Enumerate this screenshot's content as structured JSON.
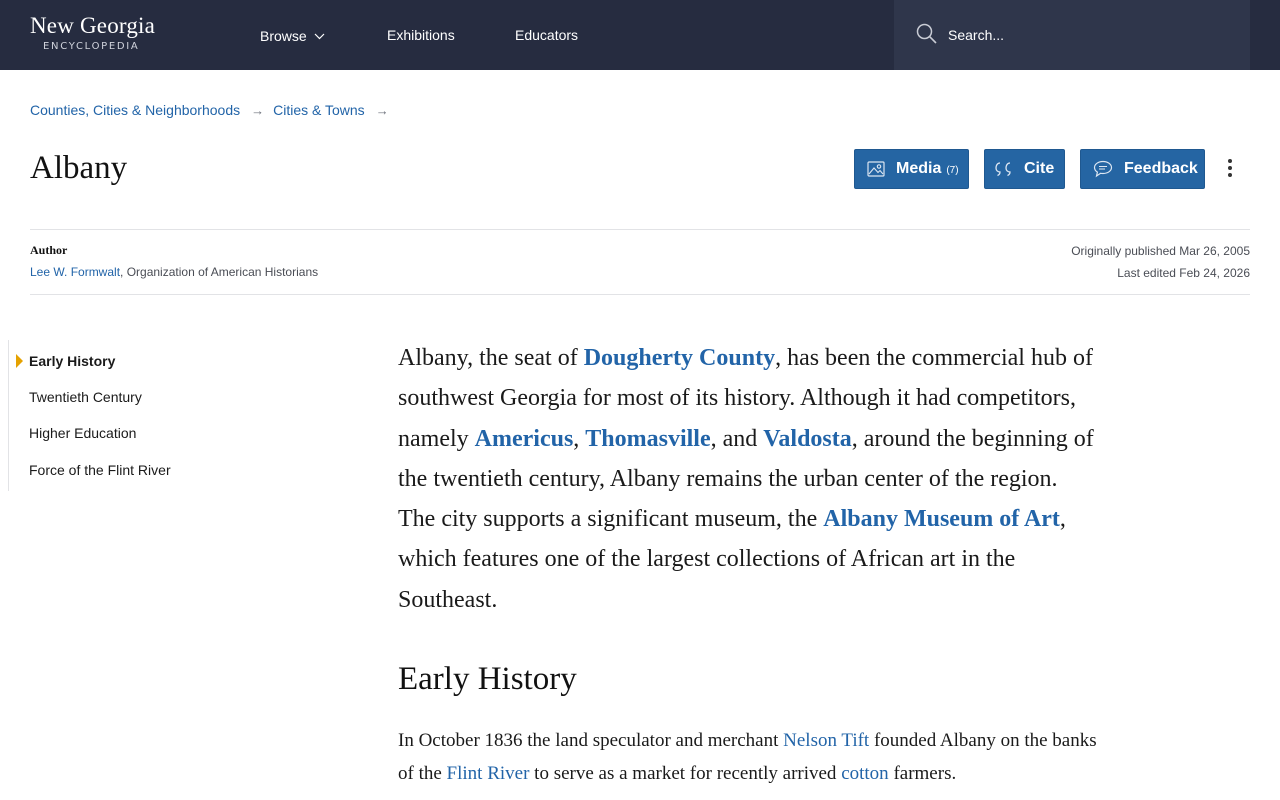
{
  "header": {
    "logo_main": "New Georgia",
    "logo_sub": "ENCYCLOPEDIA",
    "nav": {
      "browse": "Browse",
      "exhibitions": "Exhibitions",
      "educators": "Educators"
    },
    "search_placeholder": "Search...",
    "colors": {
      "bar": "#262c40",
      "search_bg": "#2f364b"
    }
  },
  "breadcrumb": [
    "Counties, Cities & Neighborhoods",
    "Cities & Towns"
  ],
  "title": "Albany",
  "actions": {
    "media_label": "Media",
    "media_count": "(7)",
    "cite_label": "Cite",
    "feedback_label": "Feedback"
  },
  "meta": {
    "author_heading": "Author",
    "author_name": "Lee W. Formwalt",
    "author_affiliation": ", Organization of American Historians",
    "published": "Originally published Mar 26, 2005",
    "edited": "Last edited Feb 24, 2026"
  },
  "toc": [
    "Early History",
    "Twentieth Century",
    "Higher Education",
    "Force of the Flint River"
  ],
  "intro": {
    "t1": "Albany, the seat of ",
    "l1": "Dougherty County",
    "t2": ", has been the commercial hub of southwest Georgia for most of its history. Although it had competitors, namely ",
    "l2": "Americus",
    "t3": ", ",
    "l3": "Thomasville",
    "t4": ", and ",
    "l4": "Valdosta",
    "t5": ", around the beginning of the twentieth century, Albany remains the urban center of the region. The city supports a significant museum, the ",
    "l5": "Albany Museum of Art",
    "t6": ", which features one of the largest collections of African art in the Southeast."
  },
  "section": {
    "heading": "Early History",
    "t1": "In October 1836 the land speculator and merchant ",
    "l1": "Nelson Tift",
    "t2": " founded Albany on the banks of the ",
    "l2": "Flint River",
    "t3": " to serve as a market for recently arrived ",
    "l3": "cotton",
    "t4": " farmers."
  },
  "colors": {
    "link": "#2264a8",
    "button": "#2565a3",
    "toc_marker": "#e5a200"
  }
}
